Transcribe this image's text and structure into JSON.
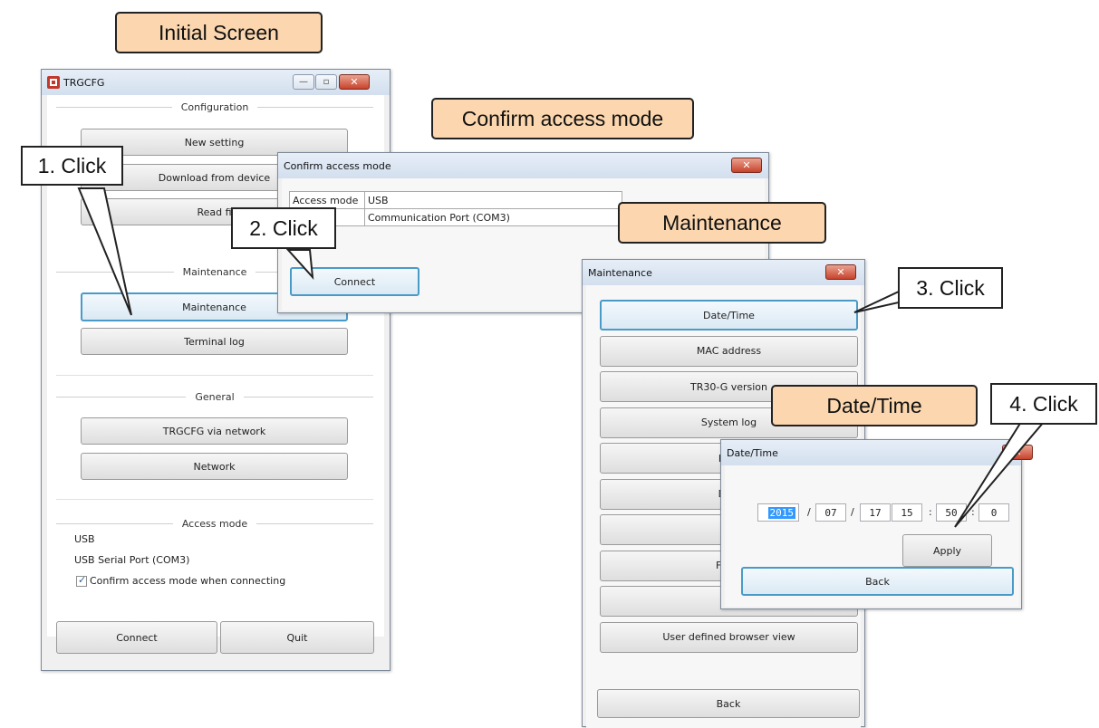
{
  "callouts": {
    "initial": "Initial Screen",
    "confirm": "Confirm access mode",
    "maintenance": "Maintenance",
    "datetime": "Date/Time"
  },
  "steps": {
    "s1": "1. Click",
    "s2": "2. Click",
    "s3": "3. Click",
    "s4": "4. Click"
  },
  "main_window": {
    "title": "TRGCFG",
    "sections": {
      "configuration": "Configuration",
      "maintenance": "Maintenance",
      "general": "General",
      "access_mode": "Access mode"
    },
    "buttons": {
      "new_setting": "New setting",
      "download": "Download from device",
      "read_file": "Read fi",
      "maintenance": "Maintenance",
      "terminal_log": "Terminal log",
      "trgcfg_network": "TRGCFG via network",
      "network": "Network",
      "connect": "Connect",
      "quit": "Quit"
    },
    "access_mode_value": "USB",
    "port": "USB Serial Port (COM3)",
    "confirm_checkbox_label": "Confirm access mode when connecting",
    "confirm_checked": true
  },
  "confirm_dialog": {
    "title": "Confirm access mode",
    "label": "Access mode",
    "value": "USB",
    "port": "Communication Port (COM3)",
    "connect": "Connect"
  },
  "maintenance_dialog": {
    "title": "Maintenance",
    "items": [
      "Date/Time",
      "MAC address",
      "TR30-G version",
      "System log",
      "Pres",
      "Disk",
      "Ini",
      "FTP c",
      "Tes",
      "User defined browser view"
    ],
    "back": "Back"
  },
  "datetime_dialog": {
    "title": "Date/Time",
    "year": "2015",
    "month": "07",
    "day": "17",
    "hour": "15",
    "minute": "50",
    "second": "0",
    "date_sep": "/",
    "time_sep": ":",
    "apply": "Apply",
    "back": "Back"
  },
  "icons": {
    "app": "app-icon",
    "close": "close-icon",
    "minimize": "minimize-icon",
    "maximize": "maximize-icon",
    "check": "checkmark-icon"
  }
}
